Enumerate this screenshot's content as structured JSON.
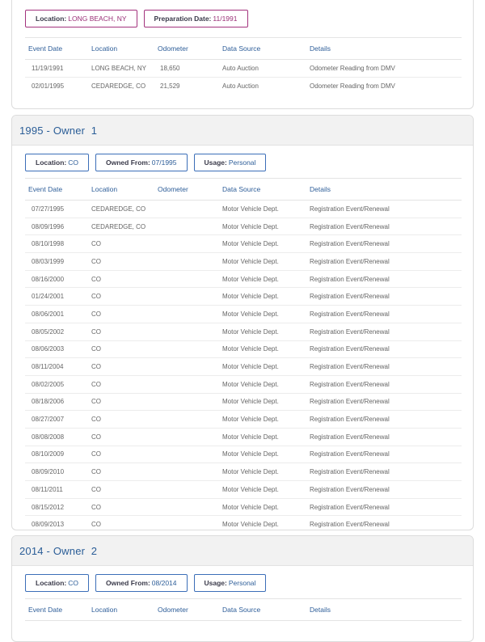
{
  "prior_section": {
    "chips": [
      {
        "key": "Location:",
        "value": "LONG BEACH, NY"
      },
      {
        "key": "Preparation Date:",
        "value": "11/1991"
      }
    ],
    "columns": [
      "Event Date",
      "Location",
      "Odometer",
      "Data Source",
      "Details"
    ],
    "rows": [
      [
        "11/19/1991",
        "LONG BEACH, NY",
        "18,650",
        "Auto Auction",
        "Odometer Reading from DMV"
      ],
      [
        "02/01/1995",
        "CEDAREDGE, CO",
        "21,529",
        "Auto Auction",
        "Odometer Reading from DMV"
      ]
    ]
  },
  "owner1": {
    "title": "1995 - Owner  1",
    "chips": [
      {
        "key": "Location:",
        "value": "CO"
      },
      {
        "key": "Owned From:",
        "value": "07/1995"
      },
      {
        "key": "Usage:",
        "value": "Personal"
      }
    ],
    "columns": [
      "Event Date",
      "Location",
      "Odometer",
      "Data Source",
      "Details"
    ],
    "rows": [
      [
        "07/27/1995",
        "CEDAREDGE, CO",
        "",
        "Motor Vehicle Dept.",
        "Registration Event/Renewal"
      ],
      [
        "08/09/1996",
        "CEDAREDGE, CO",
        "",
        "Motor Vehicle Dept.",
        "Registration Event/Renewal"
      ],
      [
        "08/10/1998",
        "CO",
        "",
        "Motor Vehicle Dept.",
        "Registration Event/Renewal"
      ],
      [
        "08/03/1999",
        "CO",
        "",
        "Motor Vehicle Dept.",
        "Registration Event/Renewal"
      ],
      [
        "08/16/2000",
        "CO",
        "",
        "Motor Vehicle Dept.",
        "Registration Event/Renewal"
      ],
      [
        "01/24/2001",
        "CO",
        "",
        "Motor Vehicle Dept.",
        "Registration Event/Renewal"
      ],
      [
        "08/06/2001",
        "CO",
        "",
        "Motor Vehicle Dept.",
        "Registration Event/Renewal"
      ],
      [
        "08/05/2002",
        "CO",
        "",
        "Motor Vehicle Dept.",
        "Registration Event/Renewal"
      ],
      [
        "08/06/2003",
        "CO",
        "",
        "Motor Vehicle Dept.",
        "Registration Event/Renewal"
      ],
      [
        "08/11/2004",
        "CO",
        "",
        "Motor Vehicle Dept.",
        "Registration Event/Renewal"
      ],
      [
        "08/02/2005",
        "CO",
        "",
        "Motor Vehicle Dept.",
        "Registration Event/Renewal"
      ],
      [
        "08/18/2006",
        "CO",
        "",
        "Motor Vehicle Dept.",
        "Registration Event/Renewal"
      ],
      [
        "08/27/2007",
        "CO",
        "",
        "Motor Vehicle Dept.",
        "Registration Event/Renewal"
      ],
      [
        "08/08/2008",
        "CO",
        "",
        "Motor Vehicle Dept.",
        "Registration Event/Renewal"
      ],
      [
        "08/10/2009",
        "CO",
        "",
        "Motor Vehicle Dept.",
        "Registration Event/Renewal"
      ],
      [
        "08/09/2010",
        "CO",
        "",
        "Motor Vehicle Dept.",
        "Registration Event/Renewal"
      ],
      [
        "08/11/2011",
        "CO",
        "",
        "Motor Vehicle Dept.",
        "Registration Event/Renewal"
      ],
      [
        "08/15/2012",
        "CO",
        "",
        "Motor Vehicle Dept.",
        "Registration Event/Renewal"
      ],
      [
        "08/09/2013",
        "CO",
        "",
        "Motor Vehicle Dept.",
        "Registration Event/Renewal"
      ]
    ]
  },
  "owner2": {
    "title": "2014 - Owner  2",
    "chips": [
      {
        "key": "Location:",
        "value": "CO"
      },
      {
        "key": "Owned From:",
        "value": "08/2014"
      },
      {
        "key": "Usage:",
        "value": "Personal"
      }
    ],
    "columns": [
      "Event Date",
      "Location",
      "Odometer",
      "Data Source",
      "Details"
    ],
    "rows": []
  },
  "colors": {
    "accent_blue": "#3b6eb8",
    "accent_purple": "#a3327d",
    "header_bg": "#f2f2f2"
  }
}
